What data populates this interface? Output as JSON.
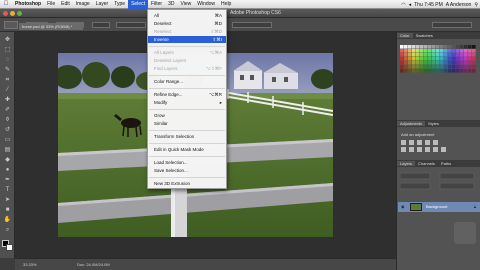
{
  "menubar": {
    "items": [
      "Photoshop",
      "File",
      "Edit",
      "Image",
      "Layer",
      "Type",
      "Select",
      "Filter",
      "3D",
      "View",
      "Window",
      "Help"
    ],
    "active": "Select",
    "clock": "Thu 7:45 PM",
    "user": "A Anderson"
  },
  "ps_title": "Adobe Photoshop CS6",
  "document": {
    "tab": "horse.psd @ 33% (RGB/8) *",
    "zoom": "33.33%",
    "doc_info": "Doc: 24.0M/24.0M"
  },
  "select_menu": {
    "items": [
      {
        "label": "All",
        "shortcut": "⌘A",
        "enabled": true
      },
      {
        "label": "Deselect",
        "shortcut": "⌘D",
        "enabled": true
      },
      {
        "label": "Reselect",
        "shortcut": "⇧⌘D",
        "enabled": false
      },
      {
        "label": "Inverse",
        "shortcut": "⇧⌘I",
        "enabled": true,
        "highlighted": true
      },
      {
        "label": "All Layers",
        "shortcut": "⌥⌘A",
        "enabled": false
      },
      {
        "label": "Deselect Layers",
        "shortcut": "",
        "enabled": false
      },
      {
        "label": "Find Layers",
        "shortcut": "⌥⇧⌘F",
        "enabled": false
      },
      {
        "label": "Color Range...",
        "shortcut": "",
        "enabled": true
      },
      {
        "label": "Refine Edge...",
        "shortcut": "⌥⌘R",
        "enabled": true
      },
      {
        "label": "Modify",
        "shortcut": "▸",
        "enabled": true
      },
      {
        "label": "Grow",
        "shortcut": "",
        "enabled": true
      },
      {
        "label": "Similar",
        "shortcut": "",
        "enabled": true
      },
      {
        "label": "Transform Selection",
        "shortcut": "",
        "enabled": true
      },
      {
        "label": "Edit in Quick Mask Mode",
        "shortcut": "",
        "enabled": true
      },
      {
        "label": "Load Selection...",
        "shortcut": "",
        "enabled": true
      },
      {
        "label": "Save Selection...",
        "shortcut": "",
        "enabled": true
      },
      {
        "label": "New 3D Extrusion",
        "shortcut": "",
        "enabled": true
      }
    ]
  },
  "panels": {
    "color_tabs": [
      "Color",
      "Swatches"
    ],
    "adj_tabs": [
      "Adjustments",
      "Styles"
    ],
    "adj_label": "Add an adjustment",
    "layer_tabs": [
      "Layers",
      "Channels",
      "Paths"
    ],
    "layer_name": "Background"
  }
}
